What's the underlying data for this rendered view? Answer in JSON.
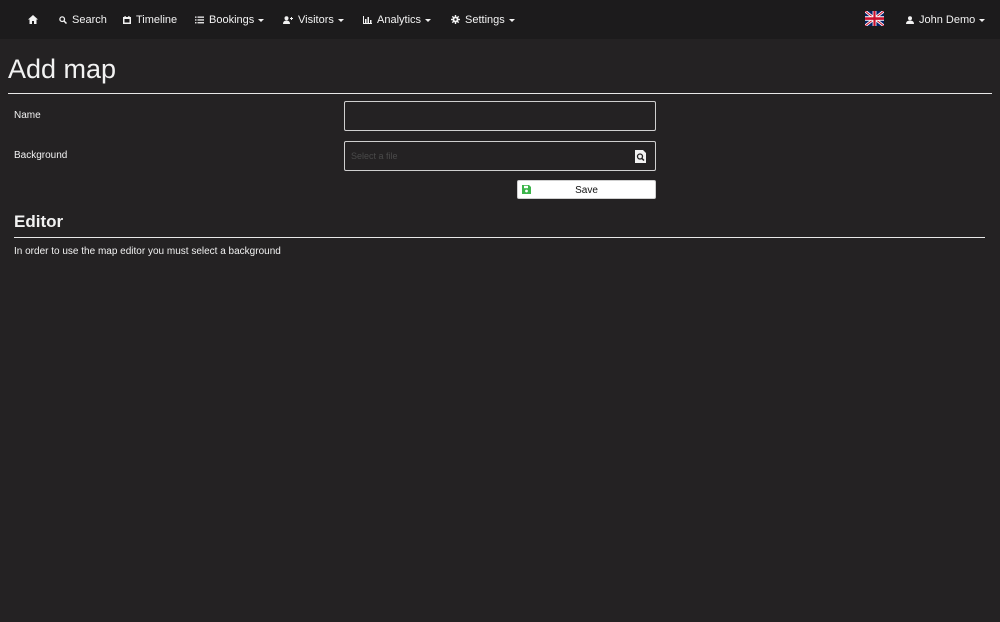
{
  "navbar": {
    "items": [
      {
        "label": "",
        "icon": "home-icon"
      },
      {
        "label": "Search",
        "icon": "search-icon"
      },
      {
        "label": "Timeline",
        "icon": "calendar-icon"
      },
      {
        "label": "Bookings",
        "icon": "list-icon",
        "dropdown": true
      },
      {
        "label": "Visitors",
        "icon": "user-add-icon",
        "dropdown": true
      },
      {
        "label": "Analytics",
        "icon": "bar-chart-icon",
        "dropdown": true
      },
      {
        "label": "Settings",
        "icon": "gear-icon",
        "dropdown": true
      }
    ],
    "language_icon": "uk-flag-icon",
    "user": {
      "label": "John Demo",
      "icon": "user-icon",
      "dropdown": true
    }
  },
  "page": {
    "title": "Add map"
  },
  "form": {
    "name_label": "Name",
    "name_value": "",
    "background_label": "Background",
    "background_placeholder": "Select a file",
    "background_value": "",
    "save_label": "Save"
  },
  "editor": {
    "heading": "Editor",
    "message": "In order to use the map editor you must select a background"
  },
  "colors": {
    "background": "#242223",
    "navbar": "#1c1b1c",
    "text": "#f2f2f2",
    "save_icon": "#3cb44a"
  }
}
